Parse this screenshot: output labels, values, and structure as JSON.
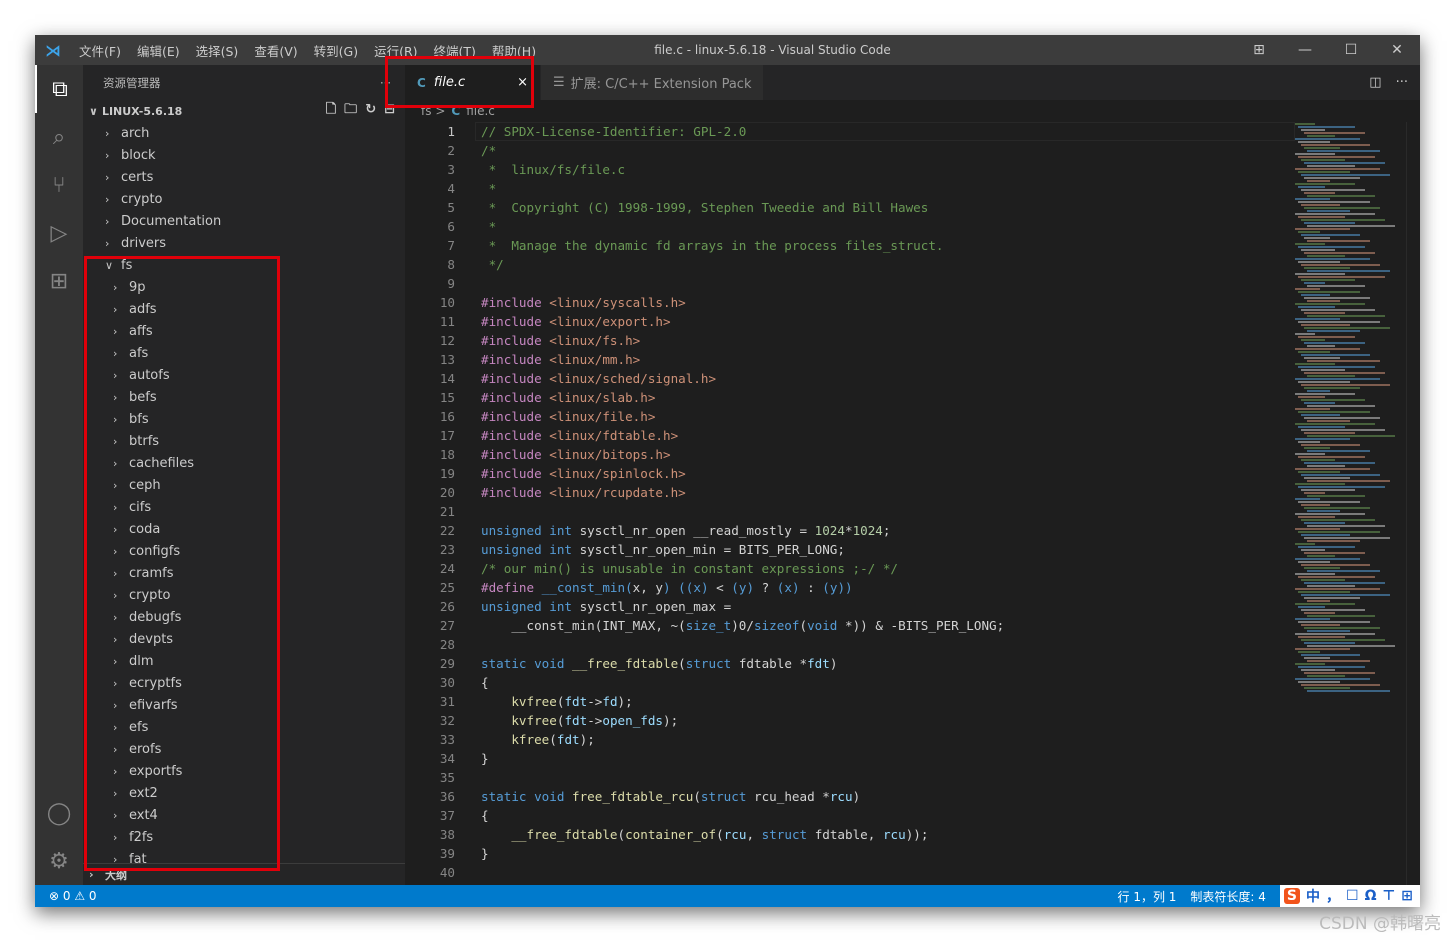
{
  "window": {
    "title": "file.c - linux-5.6.18 - Visual Studio Code",
    "menu": [
      "文件(F)",
      "编辑(E)",
      "选择(S)",
      "查看(V)",
      "转到(G)",
      "运行(R)",
      "终端(T)",
      "帮助(H)"
    ]
  },
  "sidebar": {
    "title": "资源管理器",
    "more": "···",
    "project": "LINUX-5.6.18",
    "outline": "大纲",
    "items": [
      {
        "label": "arch",
        "level": 0,
        "expanded": false
      },
      {
        "label": "block",
        "level": 0,
        "expanded": false
      },
      {
        "label": "certs",
        "level": 0,
        "expanded": false
      },
      {
        "label": "crypto",
        "level": 0,
        "expanded": false
      },
      {
        "label": "Documentation",
        "level": 0,
        "expanded": false
      },
      {
        "label": "drivers",
        "level": 0,
        "expanded": false
      },
      {
        "label": "fs",
        "level": 0,
        "expanded": true
      },
      {
        "label": "9p",
        "level": 1
      },
      {
        "label": "adfs",
        "level": 1
      },
      {
        "label": "affs",
        "level": 1
      },
      {
        "label": "afs",
        "level": 1
      },
      {
        "label": "autofs",
        "level": 1
      },
      {
        "label": "befs",
        "level": 1
      },
      {
        "label": "bfs",
        "level": 1
      },
      {
        "label": "btrfs",
        "level": 1
      },
      {
        "label": "cachefiles",
        "level": 1
      },
      {
        "label": "ceph",
        "level": 1
      },
      {
        "label": "cifs",
        "level": 1
      },
      {
        "label": "coda",
        "level": 1
      },
      {
        "label": "configfs",
        "level": 1
      },
      {
        "label": "cramfs",
        "level": 1
      },
      {
        "label": "crypto",
        "level": 1
      },
      {
        "label": "debugfs",
        "level": 1
      },
      {
        "label": "devpts",
        "level": 1
      },
      {
        "label": "dlm",
        "level": 1
      },
      {
        "label": "ecryptfs",
        "level": 1
      },
      {
        "label": "efivarfs",
        "level": 1
      },
      {
        "label": "efs",
        "level": 1
      },
      {
        "label": "erofs",
        "level": 1
      },
      {
        "label": "exportfs",
        "level": 1
      },
      {
        "label": "ext2",
        "level": 1
      },
      {
        "label": "ext4",
        "level": 1
      },
      {
        "label": "f2fs",
        "level": 1
      },
      {
        "label": "fat",
        "level": 1
      }
    ]
  },
  "tabs": [
    {
      "icon": "C",
      "label": "file.c",
      "active": true,
      "close": "×"
    },
    {
      "icon": "☰",
      "label": "扩展: C/C++ Extension Pack",
      "active": false
    }
  ],
  "breadcrumb": {
    "folder": "fs",
    "sep": ">",
    "icon": "C",
    "file": "file.c"
  },
  "code": [
    [
      [
        "c",
        "// SPDX-License-Identifier: GPL-2.0"
      ]
    ],
    [
      [
        "c",
        "/*"
      ]
    ],
    [
      [
        "c",
        " *  linux/fs/file.c"
      ]
    ],
    [
      [
        "c",
        " *"
      ]
    ],
    [
      [
        "c",
        " *  Copyright (C) 1998-1999, Stephen Tweedie and Bill Hawes"
      ]
    ],
    [
      [
        "c",
        " *"
      ]
    ],
    [
      [
        "c",
        " *  Manage the dynamic fd arrays in the process files_struct."
      ]
    ],
    [
      [
        "c",
        " */"
      ]
    ],
    [],
    [
      [
        "p",
        "#include "
      ],
      [
        "s",
        "<linux/syscalls.h>"
      ]
    ],
    [
      [
        "p",
        "#include "
      ],
      [
        "s",
        "<linux/export.h>"
      ]
    ],
    [
      [
        "p",
        "#include "
      ],
      [
        "s",
        "<linux/fs.h>"
      ]
    ],
    [
      [
        "p",
        "#include "
      ],
      [
        "s",
        "<linux/mm.h>"
      ]
    ],
    [
      [
        "p",
        "#include "
      ],
      [
        "s",
        "<linux/sched/signal.h>"
      ]
    ],
    [
      [
        "p",
        "#include "
      ],
      [
        "s",
        "<linux/slab.h>"
      ]
    ],
    [
      [
        "p",
        "#include "
      ],
      [
        "s",
        "<linux/file.h>"
      ]
    ],
    [
      [
        "p",
        "#include "
      ],
      [
        "s",
        "<linux/fdtable.h>"
      ]
    ],
    [
      [
        "p",
        "#include "
      ],
      [
        "s",
        "<linux/bitops.h>"
      ]
    ],
    [
      [
        "p",
        "#include "
      ],
      [
        "s",
        "<linux/spinlock.h>"
      ]
    ],
    [
      [
        "p",
        "#include "
      ],
      [
        "s",
        "<linux/rcupdate.h>"
      ]
    ],
    [],
    [
      [
        "k",
        "unsigned int "
      ],
      [
        "t",
        "sysctl_nr_open __read_mostly = "
      ],
      [
        "n",
        "1024"
      ],
      [
        "t",
        "*"
      ],
      [
        "n",
        "1024"
      ],
      [
        "t",
        ";"
      ]
    ],
    [
      [
        "k",
        "unsigned int "
      ],
      [
        "t",
        "sysctl_nr_open_min = BITS_PER_LONG;"
      ]
    ],
    [
      [
        "c",
        "/* our min() is unusable in constant expressions ;-/ */"
      ]
    ],
    [
      [
        "p",
        "#define "
      ],
      [
        "k",
        "__const_min"
      ],
      [
        "k",
        "("
      ],
      [
        "t",
        "x, y"
      ],
      [
        "k",
        ") (("
      ],
      [
        "k",
        "x"
      ],
      [
        "k",
        ") "
      ],
      [
        "t",
        "< "
      ],
      [
        "k",
        "(y)"
      ],
      [
        "t",
        " ? "
      ],
      [
        "k",
        "(x)"
      ],
      [
        "t",
        " : "
      ],
      [
        "k",
        "(y))"
      ]
    ],
    [
      [
        "k",
        "unsigned int "
      ],
      [
        "t",
        "sysctl_nr_open_max ="
      ]
    ],
    [
      [
        "t",
        "    __const_min(INT_MAX, ~("
      ],
      [
        "k",
        "size_t"
      ],
      [
        "t",
        ")0/"
      ],
      [
        "k",
        "sizeof"
      ],
      [
        "t",
        "("
      ],
      [
        "k",
        "void"
      ],
      [
        "t",
        " *)) & -BITS_PER_LONG;"
      ]
    ],
    [],
    [
      [
        "k",
        "static void "
      ],
      [
        "f",
        "__free_fdtable"
      ],
      [
        "t",
        "("
      ],
      [
        "k",
        "struct "
      ],
      [
        "t",
        "fdtable *"
      ],
      [
        "v",
        "fdt"
      ],
      [
        "t",
        ")"
      ]
    ],
    [
      [
        "t",
        "{"
      ]
    ],
    [
      [
        "t",
        "    "
      ],
      [
        "f",
        "kvfree"
      ],
      [
        "t",
        "("
      ],
      [
        "v",
        "fdt"
      ],
      [
        "t",
        "->"
      ],
      [
        "v",
        "fd"
      ],
      [
        "t",
        ");"
      ]
    ],
    [
      [
        "t",
        "    "
      ],
      [
        "f",
        "kvfree"
      ],
      [
        "t",
        "("
      ],
      [
        "v",
        "fdt"
      ],
      [
        "t",
        "->"
      ],
      [
        "v",
        "open_fds"
      ],
      [
        "t",
        ");"
      ]
    ],
    [
      [
        "t",
        "    "
      ],
      [
        "f",
        "kfree"
      ],
      [
        "t",
        "("
      ],
      [
        "v",
        "fdt"
      ],
      [
        "t",
        ");"
      ]
    ],
    [
      [
        "t",
        "}"
      ]
    ],
    [],
    [
      [
        "k",
        "static void "
      ],
      [
        "f",
        "free_fdtable_rcu"
      ],
      [
        "t",
        "("
      ],
      [
        "k",
        "struct "
      ],
      [
        "t",
        "rcu_head *"
      ],
      [
        "v",
        "rcu"
      ],
      [
        "t",
        ")"
      ]
    ],
    [
      [
        "t",
        "{"
      ]
    ],
    [
      [
        "t",
        "    "
      ],
      [
        "f",
        "__free_fdtable"
      ],
      [
        "t",
        "("
      ],
      [
        "f",
        "container_of"
      ],
      [
        "t",
        "("
      ],
      [
        "v",
        "rcu"
      ],
      [
        "t",
        ", "
      ],
      [
        "k",
        "struct "
      ],
      [
        "t",
        "fdtable, "
      ],
      [
        "v",
        "rcu"
      ],
      [
        "t",
        "));"
      ]
    ],
    [
      [
        "t",
        "}"
      ]
    ],
    []
  ],
  "status": {
    "errors": "0",
    "warnings": "0",
    "position": "行 1，列 1",
    "indent": "制表符长度: 4",
    "ime": [
      "S",
      "中",
      "，",
      "☐",
      "Ω",
      "⊤",
      "⊞"
    ]
  },
  "watermark": "CSDN @韩曙亮",
  "colors": {
    "accent": "#007acc",
    "highlight_box": "#e0000a"
  }
}
